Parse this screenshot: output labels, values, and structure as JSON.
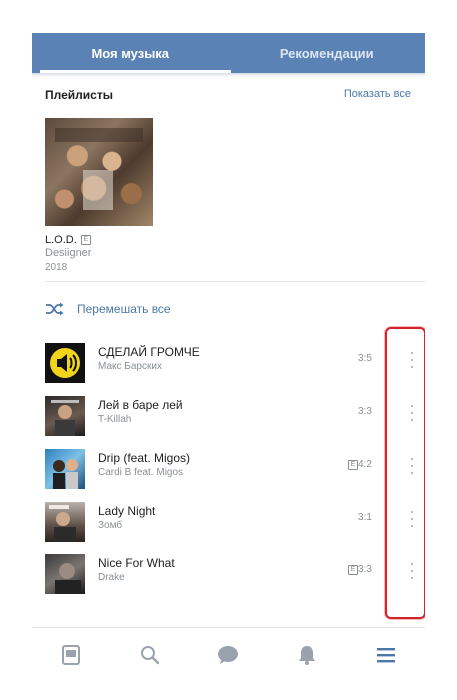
{
  "tabs": {
    "my_music": "Моя музыка",
    "recommendations": "Рекомендации"
  },
  "playlists": {
    "title": "Плейлисты",
    "show_all": "Показать все",
    "album": {
      "title": "L.O.D.",
      "explicit": "E",
      "artist": "Desiigner",
      "year": "2018"
    }
  },
  "shuffle_label": "Перемешать все",
  "tracks": [
    {
      "title": "СДЕЛАЙ ГРОМЧЕ",
      "artist": "Макс Барских",
      "duration": "3:5",
      "explicit": false
    },
    {
      "title": "Лей в баре лей",
      "artist": "T-Killah",
      "duration": "3:3",
      "explicit": false
    },
    {
      "title": "Drip (feat. Migos)",
      "artist": "Cardi B feat. Migos",
      "duration": "4:2",
      "explicit": true
    },
    {
      "title": "Lady Night",
      "artist": "Зомб",
      "duration": "3:1",
      "explicit": false
    },
    {
      "title": "Nice For What",
      "artist": "Drake",
      "duration": "3:3",
      "explicit": true
    }
  ],
  "nav_icons": [
    "newsfeed-icon",
    "search-icon",
    "messages-icon",
    "notifications-icon",
    "menu-icon"
  ],
  "colors": {
    "header": "#5b82b4",
    "accent": "#4c78a8",
    "highlight": "#d0252b",
    "muted": "#8a8f96"
  }
}
